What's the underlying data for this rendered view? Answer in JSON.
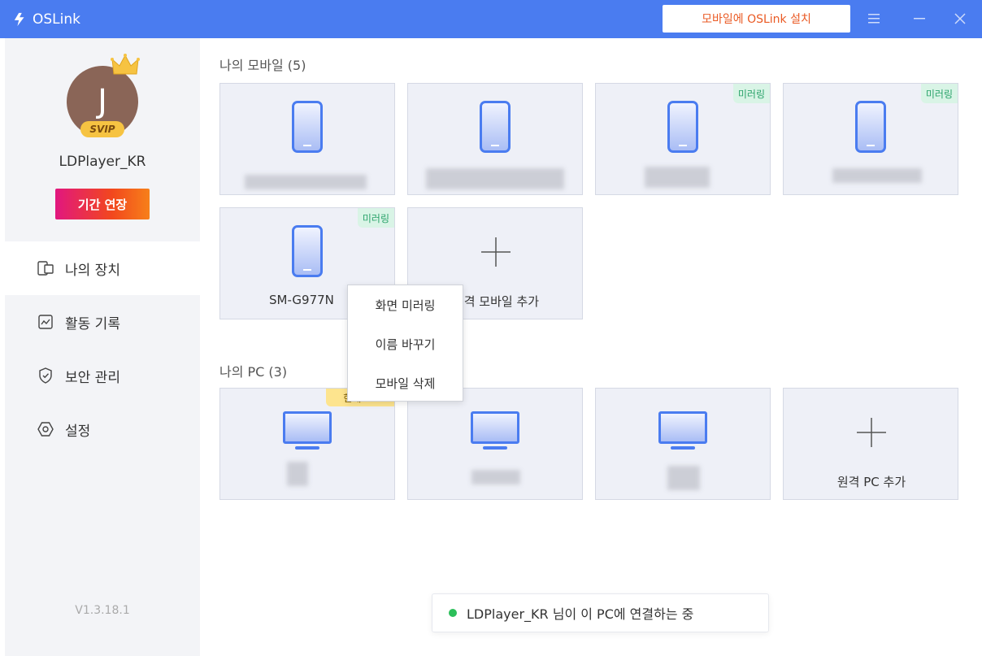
{
  "app": {
    "title": "OSLink"
  },
  "header": {
    "install_label": "모바일에 OSLink 설치",
    "brand_color": "#4a7cf0",
    "accent_color": "#ea5a24"
  },
  "profile": {
    "initial": "J",
    "badge": "SVIP",
    "username": "LDPlayer_KR",
    "extend_label": "기간 연장"
  },
  "nav": [
    {
      "label": "나의 장치",
      "icon": "device-icon",
      "active": true
    },
    {
      "label": "활동 기록",
      "icon": "activity-chart-icon",
      "active": false
    },
    {
      "label": "보안 관리",
      "icon": "shield-icon",
      "active": false
    },
    {
      "label": "설정",
      "icon": "settings-icon",
      "active": false
    }
  ],
  "version": "V1.3.18.1",
  "mobiles": {
    "title": "나의 모바일 (5)",
    "mirror_tag": "미러링",
    "visible_device_name": "SM-G977N",
    "add_label": "원격 모바일 추가"
  },
  "pcs": {
    "title": "나의 PC (3)",
    "current_tag": "현재 PC",
    "add_label": "원격 PC 추가"
  },
  "context_menu": {
    "items": [
      "화면 미러링",
      "이름 바꾸기",
      "모바일 삭제"
    ]
  },
  "status": {
    "text": "LDPlayer_KR 님이 이 PC에 연결하는 중",
    "dot_color": "#2cbf5a"
  }
}
